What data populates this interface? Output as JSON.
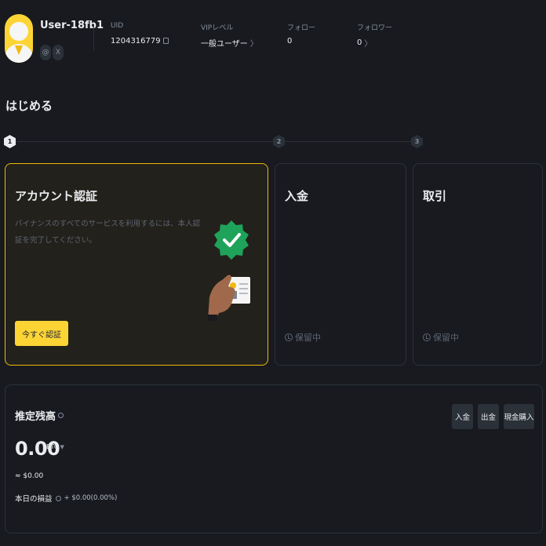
{
  "profile": {
    "username": "User-18fb1",
    "social_icons": [
      "@",
      "X"
    ],
    "uid_label": "UID",
    "uid_value": "1204316779",
    "vip_label": "VIPレベル",
    "vip_value": "一般ユーザー",
    "follow_label": "フォロー",
    "follow_value": "0",
    "follower_label": "フォロワー",
    "follower_value": "0"
  },
  "getting_started": {
    "title": "はじめる",
    "steps": [
      "1",
      "2",
      "3"
    ],
    "cards": [
      {
        "title": "アカウント認証",
        "description": "バイナンスのすべてのサービスを利用するには、本人認証を完了してください。",
        "button": "今すぐ認証"
      },
      {
        "title": "入金",
        "status": "保留中"
      },
      {
        "title": "取引",
        "status": "保留中"
      }
    ]
  },
  "balance": {
    "title": "推定残高",
    "value": "0.00",
    "unit": "BTC",
    "fiat": "≈ $0.00",
    "pnl_label": "本日の損益",
    "pnl_value": "+ $0.00(0.00%)",
    "buttons": [
      "入金",
      "出金",
      "現金購入"
    ]
  },
  "colors": {
    "background": "#181a20",
    "accent": "#fcd535",
    "card_border": "#2b3139",
    "verified_green": "#1fa35a"
  }
}
